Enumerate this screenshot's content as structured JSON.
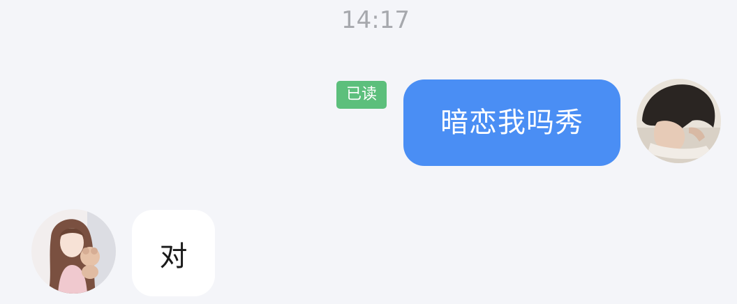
{
  "timestamp": "14:17",
  "messages": {
    "outgoing": {
      "text": "暗恋我吗秀",
      "status": "已读",
      "bubble_color": "#4a8ef4",
      "status_color": "#5cbf7c"
    },
    "incoming": {
      "text": "对",
      "bubble_color": "#ffffff"
    }
  },
  "colors": {
    "background": "#f4f5f9"
  }
}
